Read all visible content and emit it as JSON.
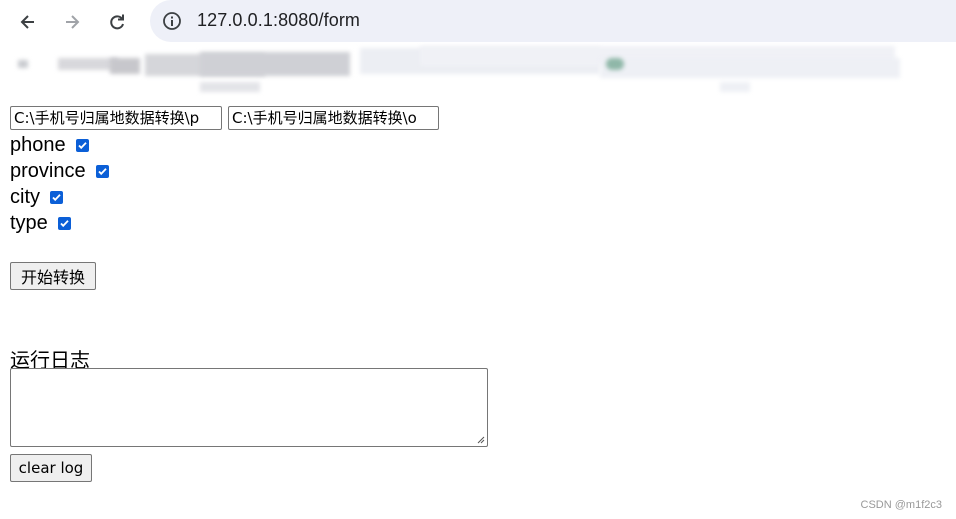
{
  "browser": {
    "url": "127.0.0.1:8080/form"
  },
  "form": {
    "input_path": "C:\\手机号归属地数据转换\\p",
    "output_path": "C:\\手机号归属地数据转换\\o",
    "fields": [
      {
        "label": "phone",
        "checked": true
      },
      {
        "label": "province",
        "checked": true
      },
      {
        "label": "city",
        "checked": true
      },
      {
        "label": "type",
        "checked": true
      }
    ],
    "start_button": "开始转换",
    "log_label": "运行日志",
    "log_text": "",
    "clear_button": "clear log"
  },
  "watermark": "CSDN @m1f2c3"
}
